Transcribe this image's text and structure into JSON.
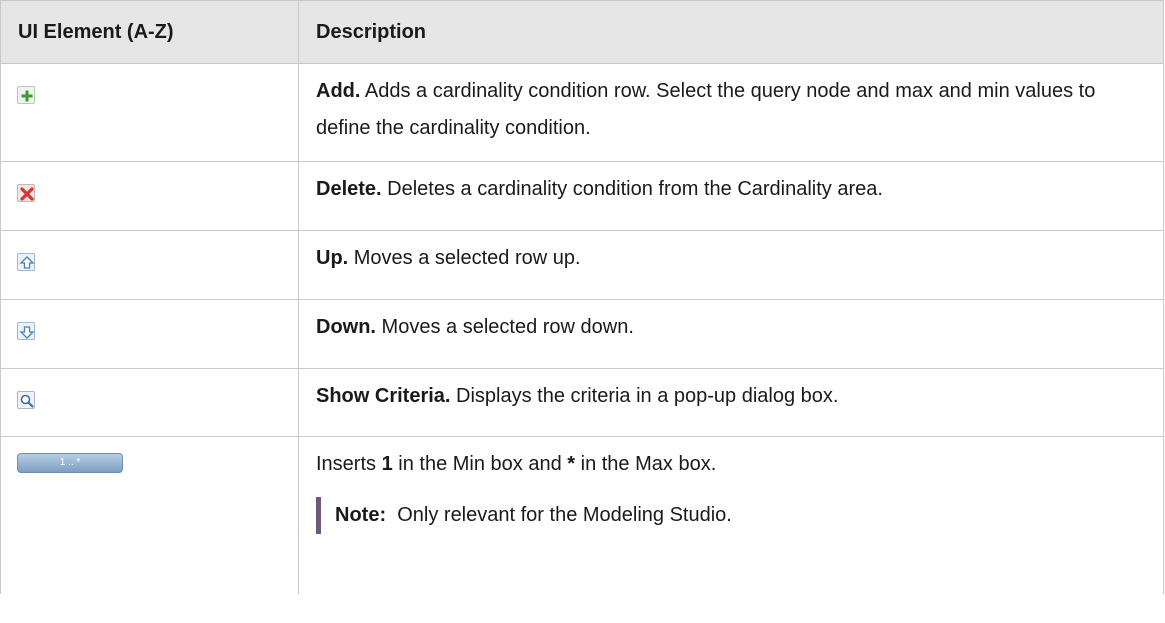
{
  "table": {
    "headers": [
      "UI Element (A-Z)",
      "Description"
    ],
    "rows": [
      {
        "icon": "add-icon",
        "term": "Add.",
        "text": " Adds a cardinality condition row. Select the query node and max and min values to define the cardinality condition."
      },
      {
        "icon": "delete-icon",
        "term": "Delete.",
        "text": " Deletes a cardinality condition from the Cardinality area."
      },
      {
        "icon": "up-arrow-icon",
        "term": "Up.",
        "text": " Moves a selected row up."
      },
      {
        "icon": "down-arrow-icon",
        "term": "Down.",
        "text": " Moves a selected row down."
      },
      {
        "icon": "magnifier-icon",
        "term": "Show Criteria.",
        "text": " Displays the criteria in a pop-up dialog box."
      },
      {
        "button_label": "1 .. *",
        "text_a": "Inserts ",
        "bold_a": "1",
        "text_b": " in the Min box and ",
        "bold_b": "*",
        "text_c": " in the Max box.",
        "note_label": "Note:",
        "note_text": "  Only relevant for the Modeling Studio."
      }
    ]
  },
  "colors": {
    "header_bg": "#e6e6e6",
    "border": "#c9c9c9",
    "note_bar": "#6b5a7a"
  }
}
